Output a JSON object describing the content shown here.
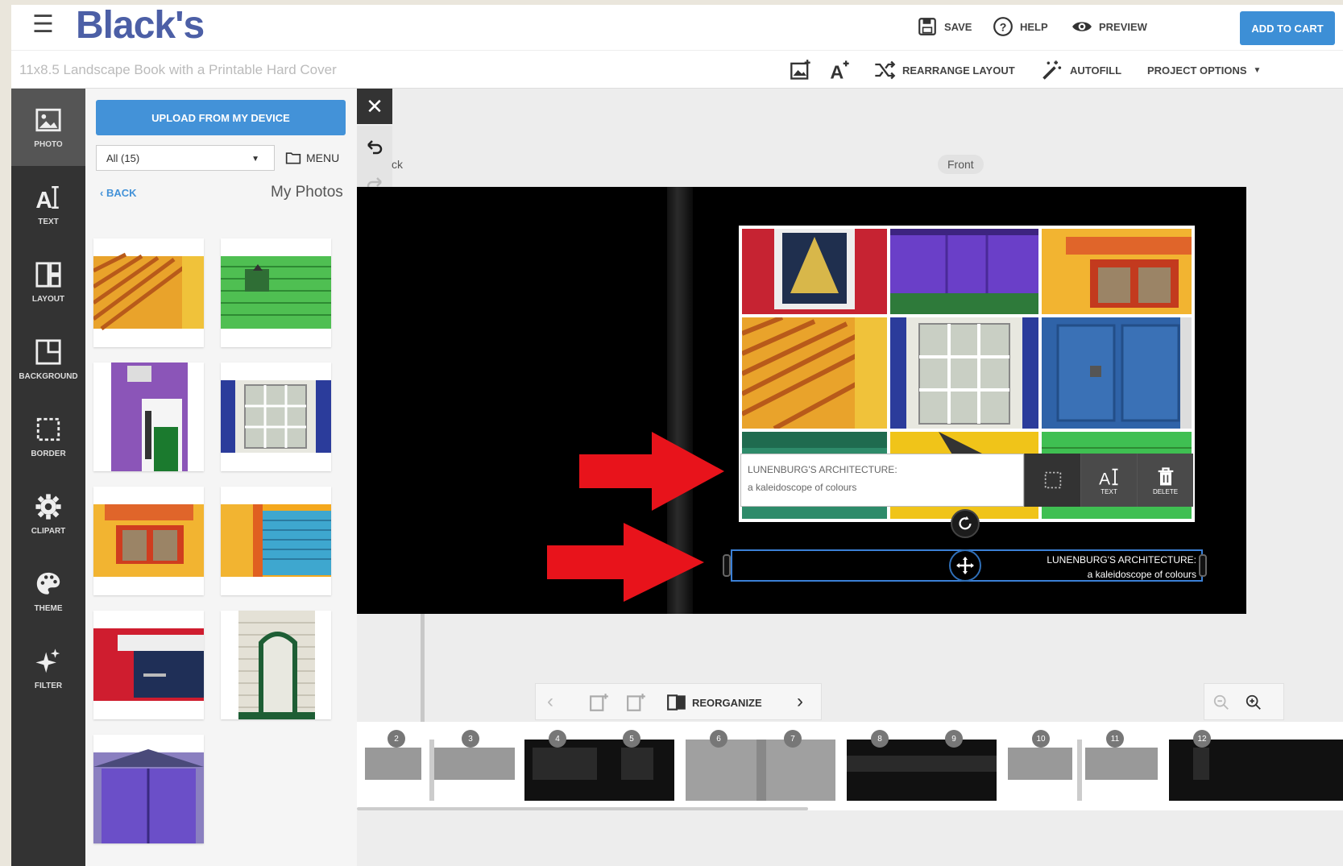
{
  "header": {
    "logo": "Black's",
    "save_label": "SAVE",
    "help_label": "HELP",
    "preview_label": "PREVIEW",
    "cart_label": "ADD TO CART"
  },
  "subbar": {
    "project_title": "11x8.5 Landscape Book with a Printable Hard Cover",
    "rearrange_label": "REARRANGE LAYOUT",
    "autofill_label": "AUTOFILL",
    "project_options_label": "PROJECT OPTIONS"
  },
  "rail": {
    "items": [
      {
        "label": "PHOTO",
        "icon": "photo-icon"
      },
      {
        "label": "TEXT",
        "icon": "text-icon"
      },
      {
        "label": "LAYOUT",
        "icon": "layout-icon"
      },
      {
        "label": "BACKGROUND",
        "icon": "background-icon"
      },
      {
        "label": "BORDER",
        "icon": "border-icon"
      },
      {
        "label": "CLIPART",
        "icon": "gear-icon"
      },
      {
        "label": "THEME",
        "icon": "palette-icon"
      },
      {
        "label": "FILTER",
        "icon": "sparkle-icon"
      }
    ]
  },
  "panel": {
    "upload_label": "UPLOAD FROM MY DEVICE",
    "filter_value": "All (15)",
    "menu_label": "MENU",
    "back_label": "BACK",
    "heading": "My Photos"
  },
  "canvas": {
    "back_label": "ck",
    "front_label": "Front",
    "text_line1": "LUNENBURG'S ARCHITECTURE:",
    "text_line2": "a kaleidoscope of colours",
    "spine_line1": "LUNENBURG'S ARCHITECTURE:",
    "spine_line2": "a kaleidoscope of colours",
    "text_btn_label": "TEXT",
    "delete_btn_label": "DELETE"
  },
  "navbar": {
    "reorganize_label": "REORGANIZE"
  },
  "pages": [
    "2",
    "3",
    "4",
    "5",
    "6",
    "7",
    "8",
    "9",
    "10",
    "11",
    "12"
  ],
  "colors": {
    "brand": "#4c5fa6",
    "accent": "#3d8fd6",
    "arrow": "#e8131b"
  }
}
